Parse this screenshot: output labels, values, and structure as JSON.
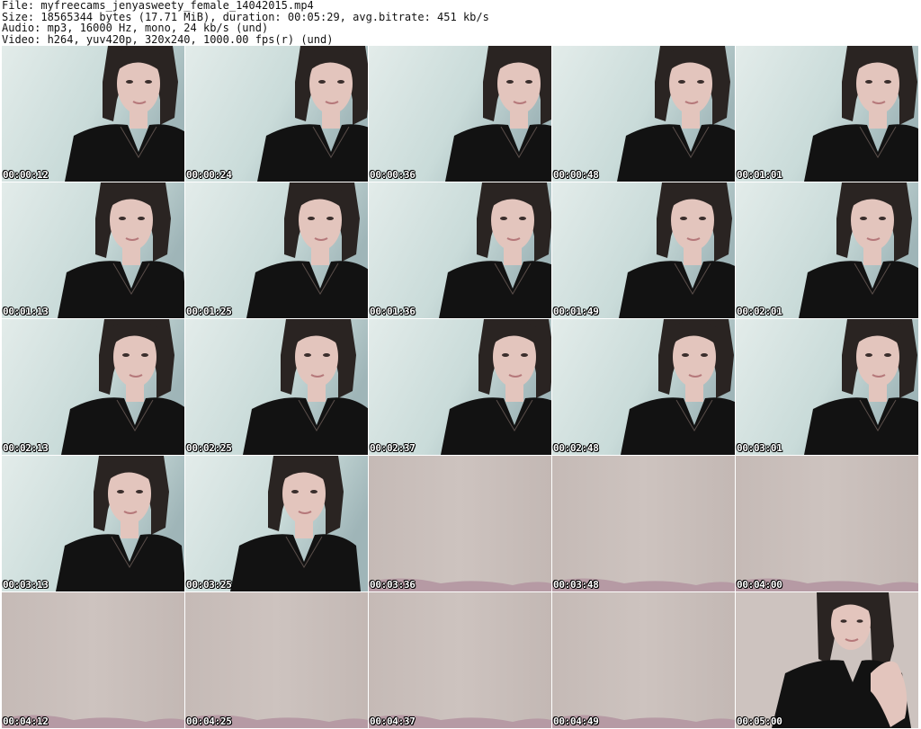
{
  "header": {
    "file_line": "File: myfreecams_jenyasweety_female_14042015.mp4",
    "size_line": "Size: 18565344 bytes (17.71 MiB), duration: 00:05:29, avg.bitrate: 451 kb/s",
    "audio_line": "Audio: mp3, 16000 Hz, mono, 24 kb/s (und)",
    "video_line": "Video: h264, yuv420p, 320x240, 1000.00 fps(r) (und)"
  },
  "thumbnails": [
    {
      "timestamp": "00:00:12",
      "scene": "person"
    },
    {
      "timestamp": "00:00:24",
      "scene": "person"
    },
    {
      "timestamp": "00:00:36",
      "scene": "person"
    },
    {
      "timestamp": "00:00:48",
      "scene": "person"
    },
    {
      "timestamp": "00:01:01",
      "scene": "person"
    },
    {
      "timestamp": "00:01:13",
      "scene": "person"
    },
    {
      "timestamp": "00:01:25",
      "scene": "person"
    },
    {
      "timestamp": "00:01:36",
      "scene": "person"
    },
    {
      "timestamp": "00:01:49",
      "scene": "person"
    },
    {
      "timestamp": "00:02:01",
      "scene": "person"
    },
    {
      "timestamp": "00:02:13",
      "scene": "person"
    },
    {
      "timestamp": "00:02:25",
      "scene": "person"
    },
    {
      "timestamp": "00:02:37",
      "scene": "person"
    },
    {
      "timestamp": "00:02:48",
      "scene": "person"
    },
    {
      "timestamp": "00:03:01",
      "scene": "person"
    },
    {
      "timestamp": "00:03:13",
      "scene": "person"
    },
    {
      "timestamp": "00:03:25",
      "scene": "person"
    },
    {
      "timestamp": "00:03:36",
      "scene": "empty"
    },
    {
      "timestamp": "00:03:48",
      "scene": "empty"
    },
    {
      "timestamp": "00:04:00",
      "scene": "empty"
    },
    {
      "timestamp": "00:04:12",
      "scene": "empty"
    },
    {
      "timestamp": "00:04:25",
      "scene": "empty"
    },
    {
      "timestamp": "00:04:37",
      "scene": "empty"
    },
    {
      "timestamp": "00:04:49",
      "scene": "empty"
    },
    {
      "timestamp": "00:05:00",
      "scene": "person"
    }
  ],
  "colors": {
    "wall_person": "#c9dbd9",
    "wall_empty": "#cdc3bf",
    "hair": "#2a2422",
    "skin": "#e3c5bd",
    "sweater": "#121212",
    "blanket": "#b69aa4"
  }
}
